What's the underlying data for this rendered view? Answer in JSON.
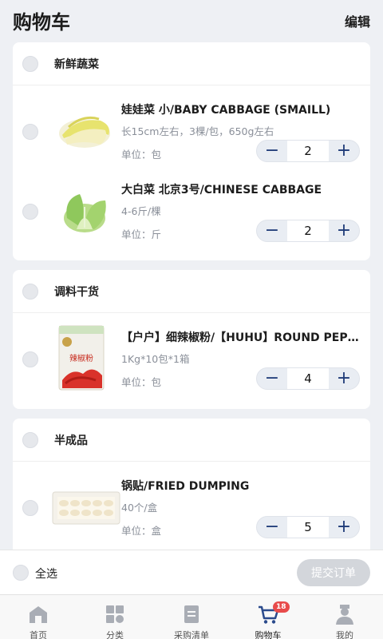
{
  "header": {
    "title": "购物车",
    "edit_label": "编辑"
  },
  "categories": [
    {
      "name": "新鲜蔬菜",
      "items": [
        {
          "name": "娃娃菜 小/BABY CABBAGE (SMAILL)",
          "spec": "长15cm左右，3棵/包，650g左右",
          "unit": "单位：包",
          "qty": "2"
        },
        {
          "name": "大白菜 北京3号/CHINESE CABBAGE",
          "spec": "4-6斤/棵",
          "unit": "单位：斤",
          "qty": "2"
        }
      ]
    },
    {
      "name": "调料干货",
      "items": [
        {
          "name": "【户户】细辣椒粉/【HUHU】ROUND PEPPER POWDER",
          "spec": "1Kg*10包*1箱",
          "unit": "单位：包",
          "qty": "4",
          "package_text": "辣椒粉"
        }
      ]
    },
    {
      "name": "半成品",
      "items": [
        {
          "name": "锅贴/FRIED DUMPING",
          "spec": "40个/盒",
          "unit": "单位：盒",
          "qty": "5"
        }
      ]
    }
  ],
  "footer": {
    "select_all": "全选",
    "submit": "提交订单"
  },
  "tabbar": [
    {
      "label": "首页",
      "icon": "home-icon"
    },
    {
      "label": "分类",
      "icon": "category-icon"
    },
    {
      "label": "采购清单",
      "icon": "list-icon"
    },
    {
      "label": "购物车",
      "icon": "cart-icon",
      "badge": "18"
    },
    {
      "label": "我的",
      "icon": "profile-icon"
    }
  ],
  "colors": {
    "accent": "#1f3b78",
    "badge": "#e84b4b",
    "background": "#eef0f4"
  }
}
